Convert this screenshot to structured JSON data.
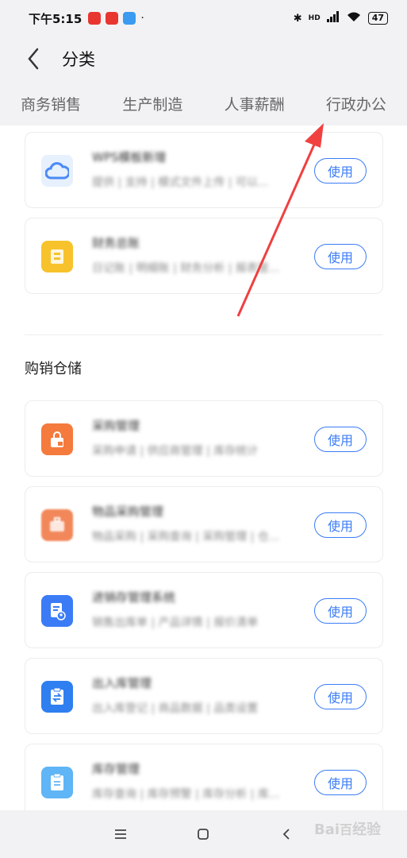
{
  "status_bar": {
    "time": "下午5:15",
    "network": "HD",
    "battery": "47",
    "app_dots": [
      "#e8352f",
      "#e8352f",
      "#3a9bf0"
    ]
  },
  "header": {
    "title": "分类"
  },
  "tabs": [
    "商务销售",
    "生产制造",
    "人事薪酬",
    "行政办公"
  ],
  "section_top": {
    "cards": [
      {
        "title": "WPS模板新增",
        "desc": "提供 | 支持 | 模式文件上传 | 可以...",
        "icon": "cloud-icon",
        "icon_color": "#4a8af4",
        "icon_bg": "#e7f0fd",
        "button": "使用"
      },
      {
        "title": "财务总账",
        "desc": "日记账 | 明细账 | 财务分析 | 报表管...",
        "icon": "ledger-icon",
        "icon_color": "#ffffff",
        "icon_bg": "#f7c22b",
        "button": "使用"
      }
    ]
  },
  "section_purchase": {
    "title": "购销仓储",
    "cards": [
      {
        "title": "采购管理",
        "desc": "采购申请 | 供应商管理 | 库存统计",
        "desc_tail": "计",
        "icon": "bag-icon",
        "icon_color": "#ffffff",
        "icon_bg": "#f57a3d",
        "button": "使用"
      },
      {
        "title": "物品采购管理",
        "desc": "物品采购 | 采购查询 | 采购管理 | 仓...",
        "desc_tail": "| 仓...",
        "icon": "briefcase-icon",
        "icon_color": "#ffffff",
        "icon_bg": "#f2875a",
        "button": "使用"
      },
      {
        "title": "进销存管理系统",
        "desc": "销售出库单 | 产品详情 | 报价清单",
        "desc_tail": "报价清单",
        "icon": "user-doc-icon",
        "icon_color": "#ffffff",
        "icon_bg": "#3b7cf6",
        "button": "使用"
      },
      {
        "title": "出入库管理",
        "desc": "出入库登记 | 商品数据 | 品类设置",
        "desc_tail": "品类设置",
        "icon": "clipboard-transfer-icon",
        "icon_color": "#ffffff",
        "icon_bg": "#2f7ff0",
        "button": "使用"
      },
      {
        "title": "库存管理",
        "desc": "库存查询 | 库存预警 | 库存分析 | 库...",
        "desc_tail": "| 库存分析 | 库...",
        "icon": "clipboard-icon",
        "icon_color": "#ffffff",
        "icon_bg": "#5fb5f5",
        "button": "使用"
      }
    ]
  },
  "annotation": {
    "arrow_color": "#f04040"
  },
  "watermark": {
    "text": "Bai百度 经验"
  }
}
